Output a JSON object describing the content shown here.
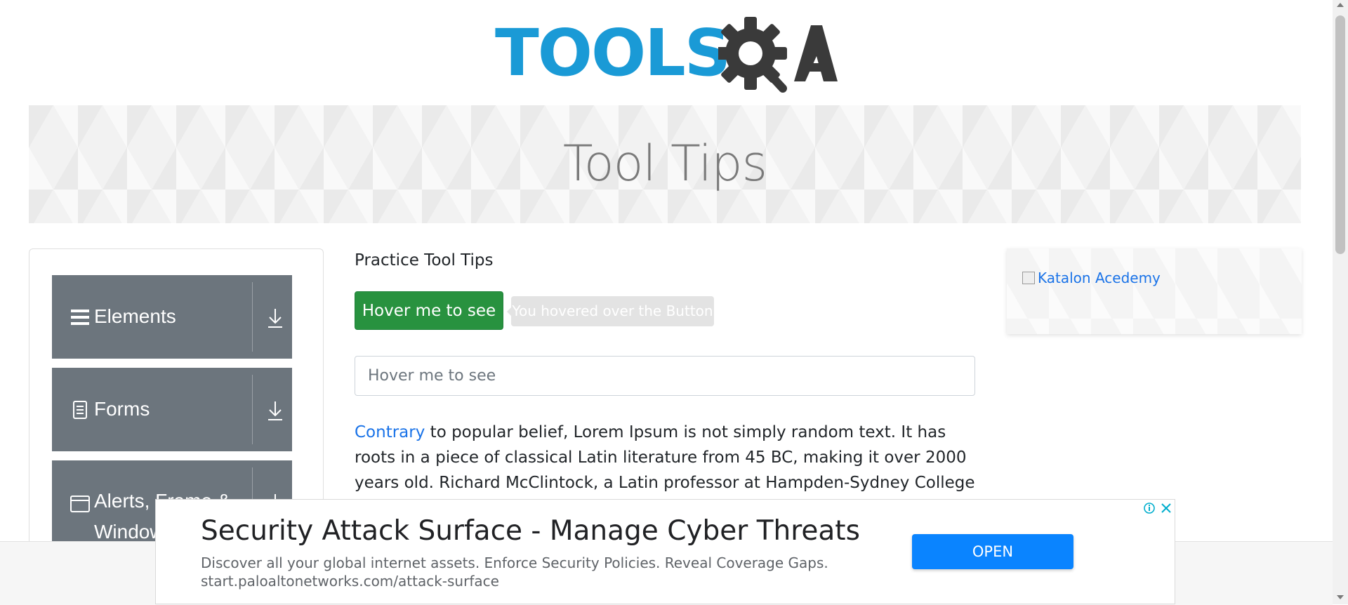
{
  "logo": {
    "text_tools": "TOOLS",
    "text_qa": "A",
    "brand_blue": "#1a9ad6",
    "brand_dark": "#3a3a3a"
  },
  "banner": {
    "title": "Tool Tips"
  },
  "sidebar": {
    "groups": [
      {
        "label": "Elements",
        "icon": "hamburger-icon"
      },
      {
        "label": "Forms",
        "icon": "document-icon"
      },
      {
        "label": "Alerts, Frame & Windows",
        "icon": "window-icon"
      }
    ]
  },
  "main": {
    "heading": "Practice Tool Tips",
    "hover_button_label": "Hover me to see",
    "tooltip_text": "You hovered over the Button",
    "input_placeholder": "Hover me to see",
    "paragraph_link": "Contrary",
    "paragraph_rest": " to popular belief, Lorem Ipsum is not simply random text. It has roots in a piece of classical Latin literature from 45 BC, making it over 2000 years old. Richard McClintock, a Latin professor at Hampden-Sydney College in Virginia, looked up"
  },
  "right_ad": {
    "link_text": "Katalon Acedemy"
  },
  "bottom_ad": {
    "headline": "Security Attack Surface - Manage Cyber Threats",
    "description": "Discover all your global internet assets. Enforce Security Policies. Reveal Coverage Gaps.",
    "url": "start.paloaltonetworks.com/attack-surface",
    "button_label": "OPEN",
    "button_color": "#0a84ff"
  },
  "colors": {
    "sidebar_group_bg": "#6c757d",
    "button_green": "#28923f",
    "link_blue": "#1a73e8"
  }
}
